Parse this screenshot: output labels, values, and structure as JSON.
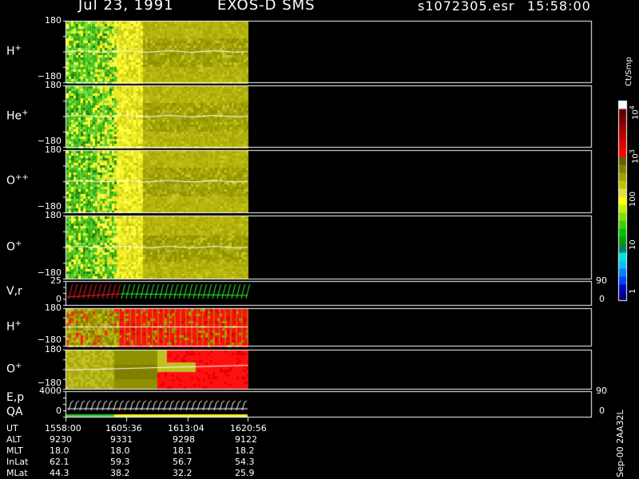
{
  "header": {
    "date": "Jul 23, 1991",
    "instrument": "EXOS-D SMS",
    "filename": "s1072305.esr",
    "time": "15:58:00"
  },
  "colors": {
    "background": "#000000",
    "axis": "#ffffff",
    "vr_red": "#ff2020",
    "vr_green": "#30ff30",
    "qa_green": "#33cc33",
    "qa_yellow": "#ffee22"
  },
  "colorbar": {
    "unit_label": "Ct/Smp",
    "tick_labels": [
      {
        "text": "1",
        "value": 1
      },
      {
        "text": "10",
        "value": 10
      },
      {
        "text": "100",
        "value": 100
      },
      {
        "text": "10",
        "sup": "3",
        "value": 1000
      },
      {
        "text": "10",
        "sup": "4",
        "value": 10000
      }
    ],
    "colors_bottom_to_top": [
      "#000080",
      "#0000c0",
      "#0040ff",
      "#0080ff",
      "#00c0ff",
      "#00e0e0",
      "#008060",
      "#00a000",
      "#00c000",
      "#40d000",
      "#80e000",
      "#c0f000",
      "#ffff00",
      "#e0e040",
      "#c0c000",
      "#a0a000",
      "#808000",
      "#606000",
      "#ff0000",
      "#e00000",
      "#c00000",
      "#a00000",
      "#800000",
      "#600000",
      "#ffffff"
    ]
  },
  "panels": [
    {
      "id": "h-plus",
      "label": "H",
      "sup": "+",
      "ymax": "180",
      "ymin": "−180",
      "kind": "spectrogram",
      "style": "cold"
    },
    {
      "id": "he-plus",
      "label": "He",
      "sup": "+",
      "ymax": "180",
      "ymin": "−180",
      "kind": "spectrogram",
      "style": "cold"
    },
    {
      "id": "o-plus-plus",
      "label": "O",
      "sup": "++",
      "ymax": "180",
      "ymin": "−180",
      "kind": "spectrogram",
      "style": "cold"
    },
    {
      "id": "o-plus",
      "label": "O",
      "sup": "+",
      "ymax": "180",
      "ymin": "−180",
      "kind": "spectrogram",
      "style": "cold"
    },
    {
      "id": "v-r",
      "label": "V,r",
      "sup": "",
      "ymax": "25",
      "ymin": "0",
      "rmax": "90",
      "rmin": "0",
      "kind": "line"
    },
    {
      "id": "h-plus-2",
      "label": "H",
      "sup": "+",
      "ymax": "180",
      "ymin": "−180",
      "kind": "spectrogram",
      "style": "hotH"
    },
    {
      "id": "o-plus-2",
      "label": "O",
      "sup": "+",
      "ymax": "180",
      "ymin": "−180",
      "kind": "spectrogram",
      "style": "hotO"
    },
    {
      "id": "e-p-qa",
      "label": "E,p",
      "label2": "QA",
      "sup": "",
      "ymax": "4000",
      "ymin": "0",
      "rmax": "90",
      "rmin": "0",
      "kind": "line2"
    }
  ],
  "ephemeris": {
    "rows": [
      {
        "label": "UT",
        "values": [
          "1558:00",
          "1605:36",
          "1613:04",
          "1620:56"
        ]
      },
      {
        "label": "ALT",
        "values": [
          "9230",
          "9331",
          "9298",
          "9122"
        ]
      },
      {
        "label": "MLT",
        "values": [
          "18.0",
          "18.0",
          "18.1",
          "18.2"
        ]
      },
      {
        "label": "InLat",
        "values": [
          "62.1",
          "59.3",
          "56.7",
          "54.3"
        ]
      },
      {
        "label": "MLat",
        "values": [
          "44.3",
          "38.2",
          "32.2",
          "25.9"
        ]
      }
    ]
  },
  "footer_note": "Sep-00 2AA32L"
}
